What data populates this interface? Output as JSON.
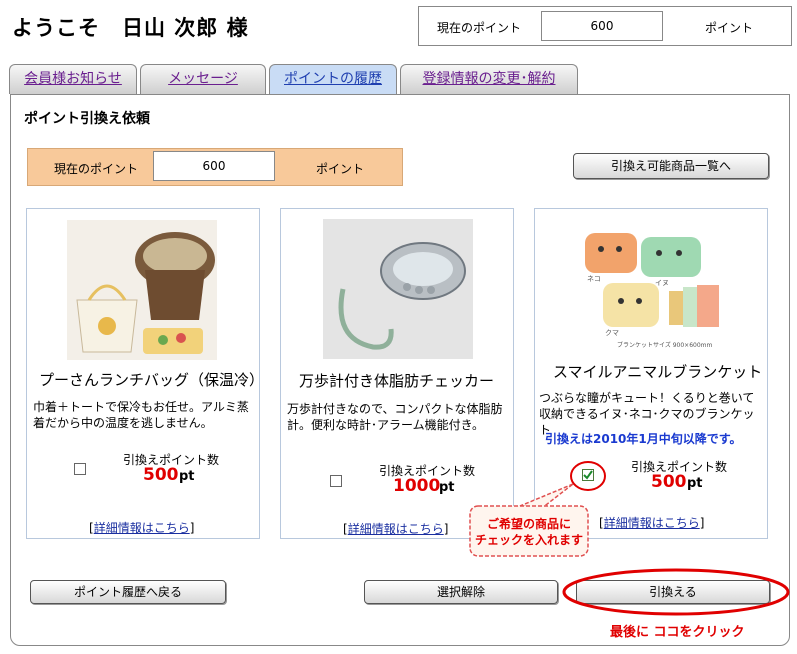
{
  "header": {
    "welcome": "ようこそ　日山 次郎 様",
    "points_label": "現在のポイント",
    "points_value": "600",
    "points_unit": "ポイント"
  },
  "tabs": [
    {
      "label": "会員様お知らせ",
      "active": false
    },
    {
      "label": "メッセージ",
      "active": false
    },
    {
      "label": "ポイントの履歴",
      "active": true
    },
    {
      "label": "登録情報の変更･解約",
      "active": false
    }
  ],
  "panel": {
    "title": "ポイント引換え依頼",
    "points_label": "現在のポイント",
    "points_value": "600",
    "points_unit": "ポイント",
    "catalog_button": "引換え可能商品一覧へ"
  },
  "products": [
    {
      "name": "プーさんランチバッグ（保温冷）",
      "description": "巾着＋トートで保冷もお任せ。アルミ蒸着だから中の温度を逃しません。",
      "notice": "",
      "points_label": "引換えポイント数",
      "points_value": "500",
      "points_unit": "pt",
      "checked": false,
      "detail_link": "詳細情報はこちら"
    },
    {
      "name": "万歩計付き体脂肪チェッカー",
      "description": "万歩計付きなので、コンパクトな体脂肪計。便利な時計･アラーム機能付き。",
      "notice": "",
      "points_label": "引換えポイント数",
      "points_value": "1000",
      "points_unit": "pt",
      "checked": false,
      "detail_link": "詳細情報はこちら"
    },
    {
      "name": "スマイルアニマルブランケット",
      "description": "つぶらな瞳がキュート！くるりと巻いて収納できるイヌ･ネコ･クマのブランケット",
      "notice": "引換えは2010年1月中旬以降です。",
      "points_label": "引換えポイント数",
      "points_value": "500",
      "points_unit": "pt",
      "checked": true,
      "detail_link": "詳細情報はこちら"
    }
  ],
  "image_text": {
    "blanket_labels": [
      "ネコ",
      "イヌ",
      "クマ"
    ],
    "blanket_size": "ブランケットサイズ 900×600mm"
  },
  "callout": {
    "line1": "ご希望の商品に",
    "line2": "チェックを入れます"
  },
  "buttons": {
    "back": "ポイント履歴へ戻る",
    "clear": "選択解除",
    "exchange": "引換える"
  },
  "annotation": "最後に ココをクリック",
  "colors": {
    "accent_red": "#e00000",
    "points_bar": "#f8c99a",
    "active_tab": "#c9dcf5",
    "notice_blue": "#1a3ad0"
  }
}
